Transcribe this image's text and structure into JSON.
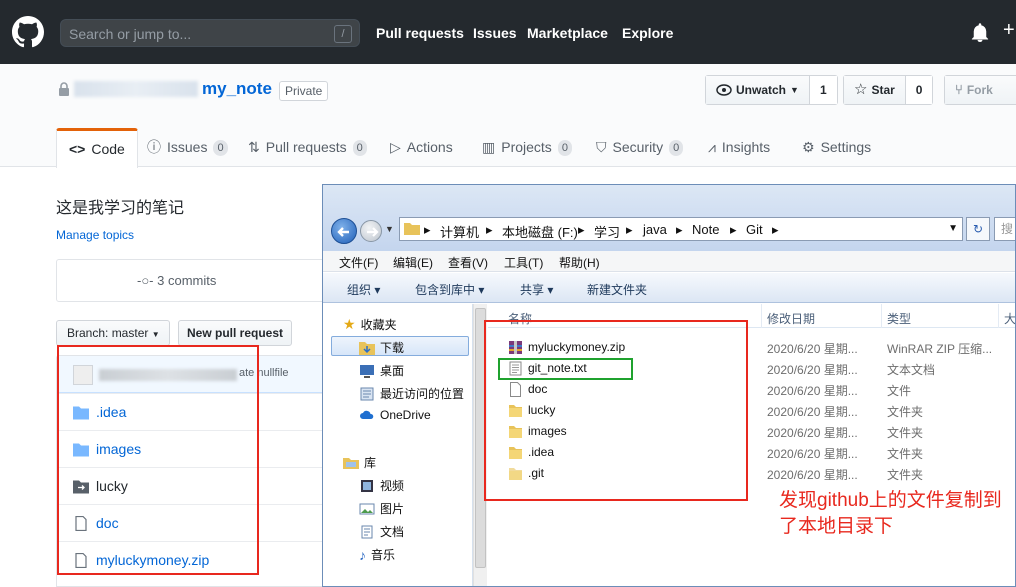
{
  "header": {
    "search_placeholder": "Search or jump to...",
    "search_shortcut": "/",
    "nav": [
      "Pull requests",
      "Issues",
      "Marketplace",
      "Explore"
    ],
    "plus": "+"
  },
  "repo": {
    "name": "my_note",
    "visibility": "Private",
    "watch": {
      "label": "Unwatch",
      "count": "1"
    },
    "star": {
      "label": "Star",
      "count": "0"
    },
    "fork": {
      "label": "Fork"
    },
    "tabs": [
      {
        "label": "Code",
        "counter": ""
      },
      {
        "label": "Issues",
        "counter": "0"
      },
      {
        "label": "Pull requests",
        "counter": "0"
      },
      {
        "label": "Actions",
        "counter": ""
      },
      {
        "label": "Projects",
        "counter": "0"
      },
      {
        "label": "Security",
        "counter": "0"
      },
      {
        "label": "Insights",
        "counter": ""
      },
      {
        "label": "Settings",
        "counter": ""
      }
    ],
    "description": "这是我学习的笔记",
    "manage_topics": "Manage topics",
    "commits": "3 commits",
    "branch": "Branch: master",
    "new_pr": "New pull request",
    "latest_commit_msg": "ate nullfile",
    "files": [
      {
        "name": ".idea",
        "kind": "folder"
      },
      {
        "name": "images",
        "kind": "folder"
      },
      {
        "name": "lucky",
        "kind": "submodule"
      },
      {
        "name": "doc",
        "kind": "file"
      },
      {
        "name": "myluckymoney.zip",
        "kind": "file"
      }
    ]
  },
  "explorer": {
    "breadcrumbs": [
      "计算机",
      "本地磁盘 (F:)",
      "学习",
      "java",
      "Note",
      "Git"
    ],
    "refresh": "↻",
    "search_placeholder": "搜",
    "menu": [
      "文件(F)",
      "编辑(E)",
      "查看(V)",
      "工具(T)",
      "帮助(H)"
    ],
    "toolbar": [
      "组织 ▾",
      "包含到库中 ▾",
      "共享 ▾",
      "新建文件夹"
    ],
    "nav_pane": [
      {
        "label": "收藏夹",
        "icon": "star-icon"
      },
      {
        "label": "下载",
        "icon": "download-folder-icon"
      },
      {
        "label": "桌面",
        "icon": "desktop-icon"
      },
      {
        "label": "最近访问的位置",
        "icon": "recent-places-icon"
      },
      {
        "label": "OneDrive",
        "icon": "cloud-icon"
      },
      {
        "label": "库",
        "icon": "library-icon"
      },
      {
        "label": "视频",
        "icon": "video-icon"
      },
      {
        "label": "图片",
        "icon": "picture-icon"
      },
      {
        "label": "文档",
        "icon": "document-icon"
      },
      {
        "label": "音乐",
        "icon": "music-icon"
      }
    ],
    "columns": [
      "名称",
      "修改日期",
      "类型",
      "大"
    ],
    "files": [
      {
        "name": "myluckymoney.zip",
        "date": "2020/6/20 星期...",
        "type": "WinRAR ZIP 压缩...",
        "icon": "zip-icon"
      },
      {
        "name": "git_note.txt",
        "date": "2020/6/20 星期...",
        "type": "文本文档",
        "icon": "text-file-icon"
      },
      {
        "name": "doc",
        "date": "2020/6/20 星期...",
        "type": "文件",
        "icon": "blank-file-icon"
      },
      {
        "name": "lucky",
        "date": "2020/6/20 星期...",
        "type": "文件夹",
        "icon": "folder-icon"
      },
      {
        "name": "images",
        "date": "2020/6/20 星期...",
        "type": "文件夹",
        "icon": "folder-icon"
      },
      {
        "name": ".idea",
        "date": "2020/6/20 星期...",
        "type": "文件夹",
        "icon": "folder-icon"
      },
      {
        "name": ".git",
        "date": "2020/6/20 星期...",
        "type": "文件夹",
        "icon": "folder-icon"
      }
    ]
  },
  "annotation": "发现github上的文件复制到了本地目录下",
  "colors": {
    "annotation_red": "#e8281e",
    "highlight_green": "#1fa22e",
    "gh_header": "#24292e",
    "link_blue": "#0366d6"
  }
}
